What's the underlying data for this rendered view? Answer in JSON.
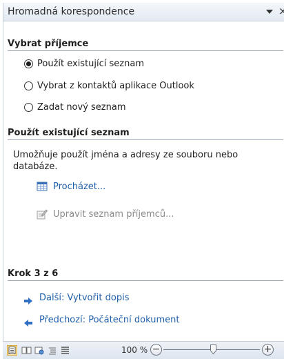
{
  "pane": {
    "title": "Hromadná korespondence",
    "dropdown_icon": "triangle-down-icon",
    "close_glyph": "×"
  },
  "select_recipients": {
    "heading": "Vybrat příjemce",
    "options": [
      {
        "label": "Použít existující seznam",
        "checked": true
      },
      {
        "label": "Vybrat z kontaktů aplikace Outlook",
        "checked": false
      },
      {
        "label": "Zadat nový seznam",
        "checked": false
      }
    ]
  },
  "use_existing": {
    "heading": "Použít existující seznam",
    "description": "Umožňuje použít jména a adresy ze souboru nebo databáze.",
    "browse_label": "Procházet...",
    "browse_icon": "table-icon",
    "edit_label": "Upravit seznam příjemců...",
    "edit_icon": "edit-list-icon"
  },
  "step": {
    "heading": "Krok 3 z 6",
    "next_label": "Další: Vytvořit dopis",
    "prev_label": "Předchozí: Počáteční dokument"
  },
  "statusbar": {
    "zoom_label": "100 %",
    "zoom_out": "−",
    "zoom_in": "+",
    "zoom_fraction": 0.5
  },
  "colors": {
    "link": "#1f5ea8",
    "arrow": "#2f6fc4"
  }
}
